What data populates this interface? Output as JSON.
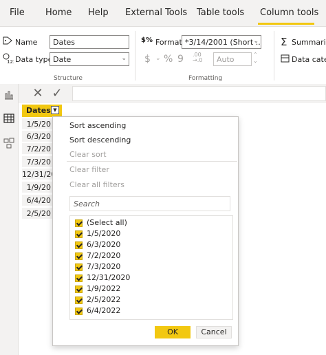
{
  "menu": {
    "items": [
      "File",
      "Home",
      "Help",
      "External Tools",
      "Table tools",
      "Column tools"
    ],
    "active": "Column tools"
  },
  "ribbon": {
    "name_label": "Name",
    "name_value": "Dates",
    "datatype_label": "Data type",
    "datatype_value": "Date",
    "structure_label": "Structure",
    "format_label": "Format",
    "format_value": "*3/14/2001 (Short ...",
    "currency_symbol": "$",
    "percent_symbol": "%",
    "comma_symbol": "9",
    "decimal_symbol": ".00→.0",
    "auto_value": "Auto",
    "formatting_label": "Formatting",
    "summarize_label": "Summariz",
    "datacategory_label": "Data categ"
  },
  "table": {
    "column_header": "Dates",
    "cells": [
      "1/5/20",
      "6/3/20",
      "7/2/20",
      "7/3/20",
      "12/31/20",
      "1/9/20",
      "6/4/20",
      "2/5/20"
    ]
  },
  "dropdown": {
    "sort_asc": "Sort ascending",
    "sort_desc": "Sort descending",
    "clear_sort": "Clear sort",
    "clear_filter": "Clear filter",
    "clear_all": "Clear all filters",
    "search_placeholder": "Search",
    "items": [
      "(Select all)",
      "1/5/2020",
      "6/3/2020",
      "7/2/2020",
      "7/3/2020",
      "12/31/2020",
      "1/9/2022",
      "2/5/2022",
      "6/4/2022"
    ],
    "ok_label": "OK",
    "cancel_label": "Cancel"
  },
  "colors": {
    "accent": "#f2c811",
    "background": "#f3f2f1"
  }
}
